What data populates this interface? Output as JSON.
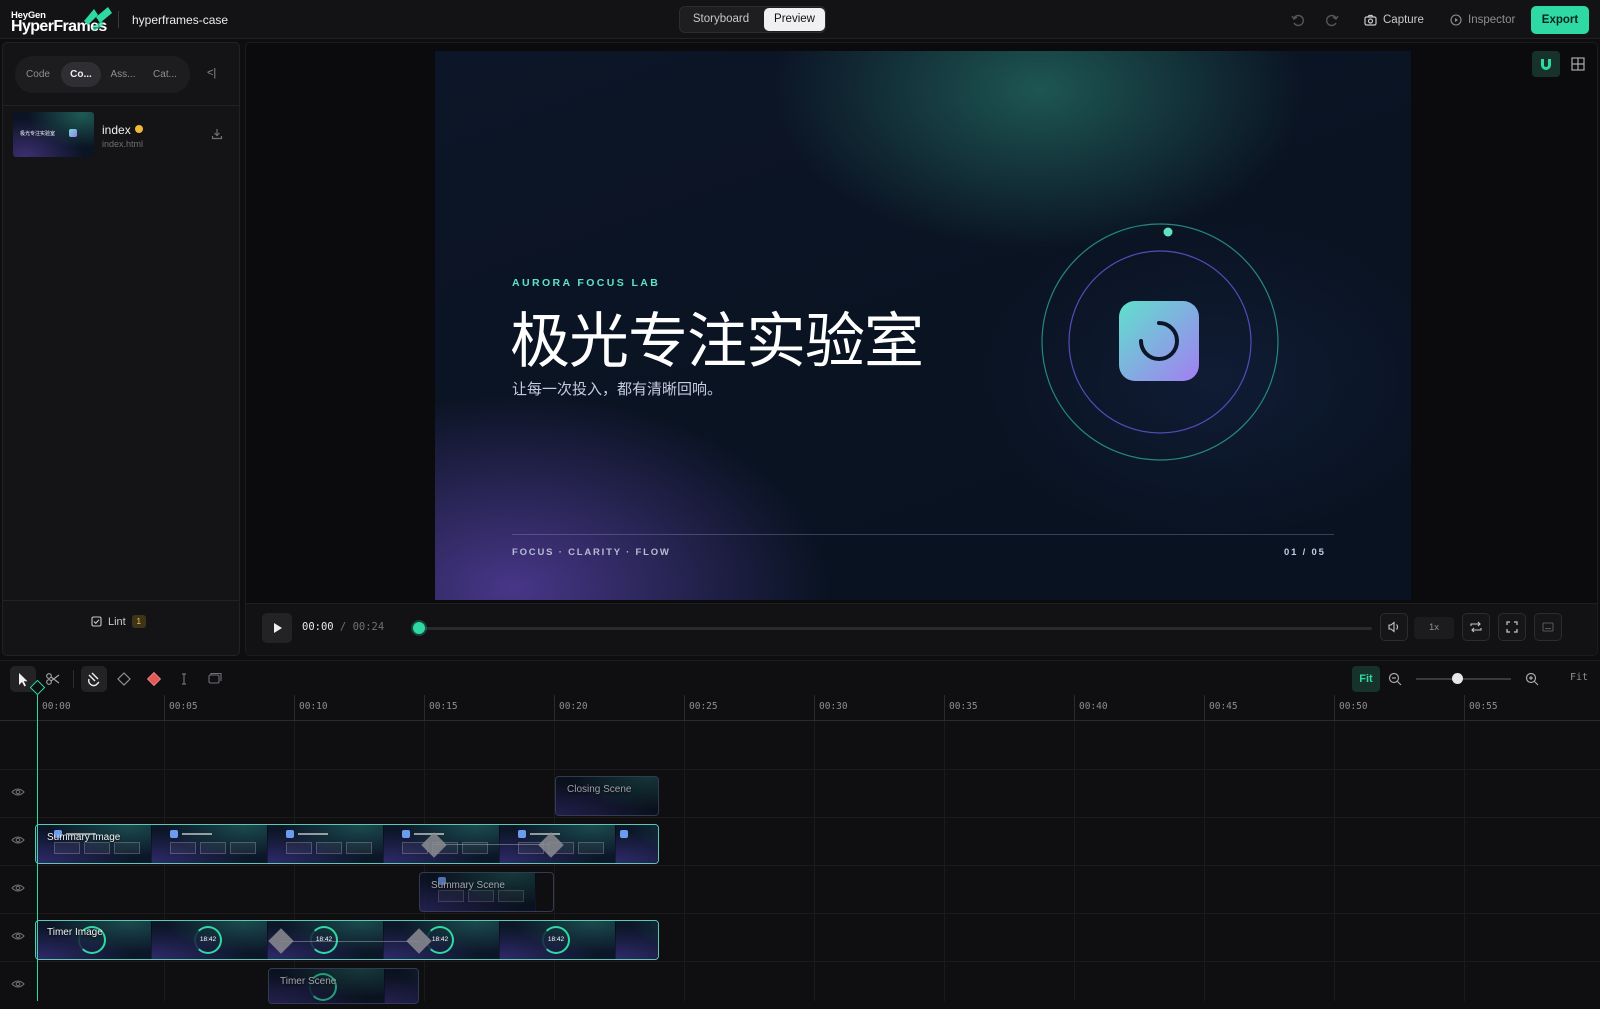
{
  "app": {
    "logo_top": "HeyGen",
    "logo_bottom": "HyperFrames",
    "project_name": "hyperframes-case"
  },
  "header": {
    "view_modes": [
      "Storyboard",
      "Preview"
    ],
    "active_view": "Preview",
    "capture_label": "Capture",
    "inspector_label": "Inspector",
    "export_label": "Export"
  },
  "sidebar": {
    "tabs": [
      "Code",
      "Co...",
      "Ass...",
      "Cat..."
    ],
    "active_tab": "Co...",
    "collapse_glyph": "<|",
    "composition": {
      "name": "index",
      "file": "index.html",
      "thumb_text": "极光专注实验室"
    },
    "lint_label": "Lint",
    "lint_count": "1"
  },
  "slide": {
    "kicker": "AURORA FOCUS LAB",
    "headline": "极光专注实验室",
    "subtitle": "让每一次投入，都有清晰回响。",
    "footer_left": "FOCUS · CLARITY · FLOW",
    "footer_right": "01 / 05"
  },
  "transport": {
    "current_time": "00:00",
    "separator": " / ",
    "total_time": "00:24",
    "speed": "1x",
    "progress": 0
  },
  "timeline": {
    "fit_label": "Fit",
    "fit_text": "Fit",
    "ticks": [
      "00:00",
      "00:05",
      "00:10",
      "00:15",
      "00:20",
      "00:25",
      "00:30",
      "00:35",
      "00:40",
      "00:45",
      "00:50",
      "00:55"
    ],
    "clips": {
      "closing_scene": "Closing Scene",
      "summary_image": "Summary Image",
      "summary_scene": "Summary Scene",
      "timer_image": "Timer Image",
      "timer_scene": "Timer Scene"
    },
    "timer_value": "18:42"
  },
  "colors": {
    "accent": "#2fd9a4",
    "lint_badge": "#f0c14b",
    "unsaved_dot": "#f2b838"
  }
}
